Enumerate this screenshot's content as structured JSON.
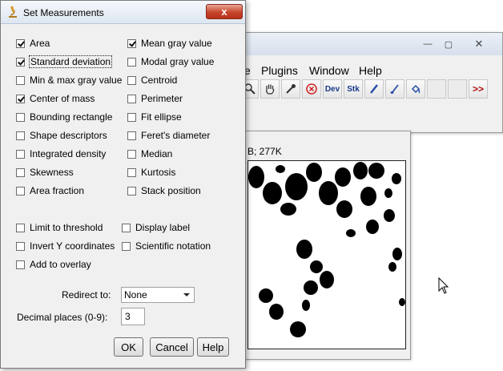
{
  "dialog": {
    "title": "Set Measurements",
    "close_glyph": "x",
    "checkboxes_col1": [
      {
        "label": "Area",
        "checked": true
      },
      {
        "label": "Standard deviation",
        "checked": true
      },
      {
        "label": "Min & max gray value",
        "checked": false
      },
      {
        "label": "Center of mass",
        "checked": true
      },
      {
        "label": "Bounding rectangle",
        "checked": false
      },
      {
        "label": "Shape descriptors",
        "checked": false
      },
      {
        "label": "Integrated density",
        "checked": false
      },
      {
        "label": "Skewness",
        "checked": false
      },
      {
        "label": "Area fraction",
        "checked": false
      }
    ],
    "checkboxes_col2": [
      {
        "label": "Mean gray value",
        "checked": true
      },
      {
        "label": "Modal gray value",
        "checked": false
      },
      {
        "label": "Centroid",
        "checked": false
      },
      {
        "label": "Perimeter",
        "checked": false
      },
      {
        "label": "Fit ellipse",
        "checked": false
      },
      {
        "label": "Feret's diameter",
        "checked": false
      },
      {
        "label": "Median",
        "checked": false
      },
      {
        "label": "Kurtosis",
        "checked": false
      },
      {
        "label": "Stack position",
        "checked": false
      }
    ],
    "options_col1": [
      {
        "label": "Limit to threshold",
        "checked": false
      },
      {
        "label": "Invert Y coordinates",
        "checked": false
      },
      {
        "label": "Add to overlay",
        "checked": false
      }
    ],
    "options_col2": [
      {
        "label": "Display label",
        "checked": false
      },
      {
        "label": "Scientific notation",
        "checked": false
      }
    ],
    "redirect_label": "Redirect to:",
    "redirect_value": "None",
    "decimal_label": "Decimal places (0-9):",
    "decimal_value": "3",
    "ok_label": "OK",
    "cancel_label": "Cancel",
    "help_label": "Help"
  },
  "imagej": {
    "menus": [
      "e",
      "Plugins",
      "Window",
      "Help"
    ],
    "tools": [
      "magnifier-icon",
      "hand-icon",
      "dropper-icon",
      "stop-icon",
      "Dev",
      "Stk",
      "pencil-icon",
      "brush-icon",
      "flood-fill-icon",
      "",
      "",
      ">>"
    ],
    "min_glyph": "—",
    "max_glyph": "▢",
    "close_glyph": "✕"
  },
  "image_window": {
    "info": "B; 277K"
  },
  "colors": {
    "close_red": "#c7452c",
    "stop_red": "#cc2222",
    "more_red": "#b01010",
    "tool_blue": "#1a3a8a"
  }
}
